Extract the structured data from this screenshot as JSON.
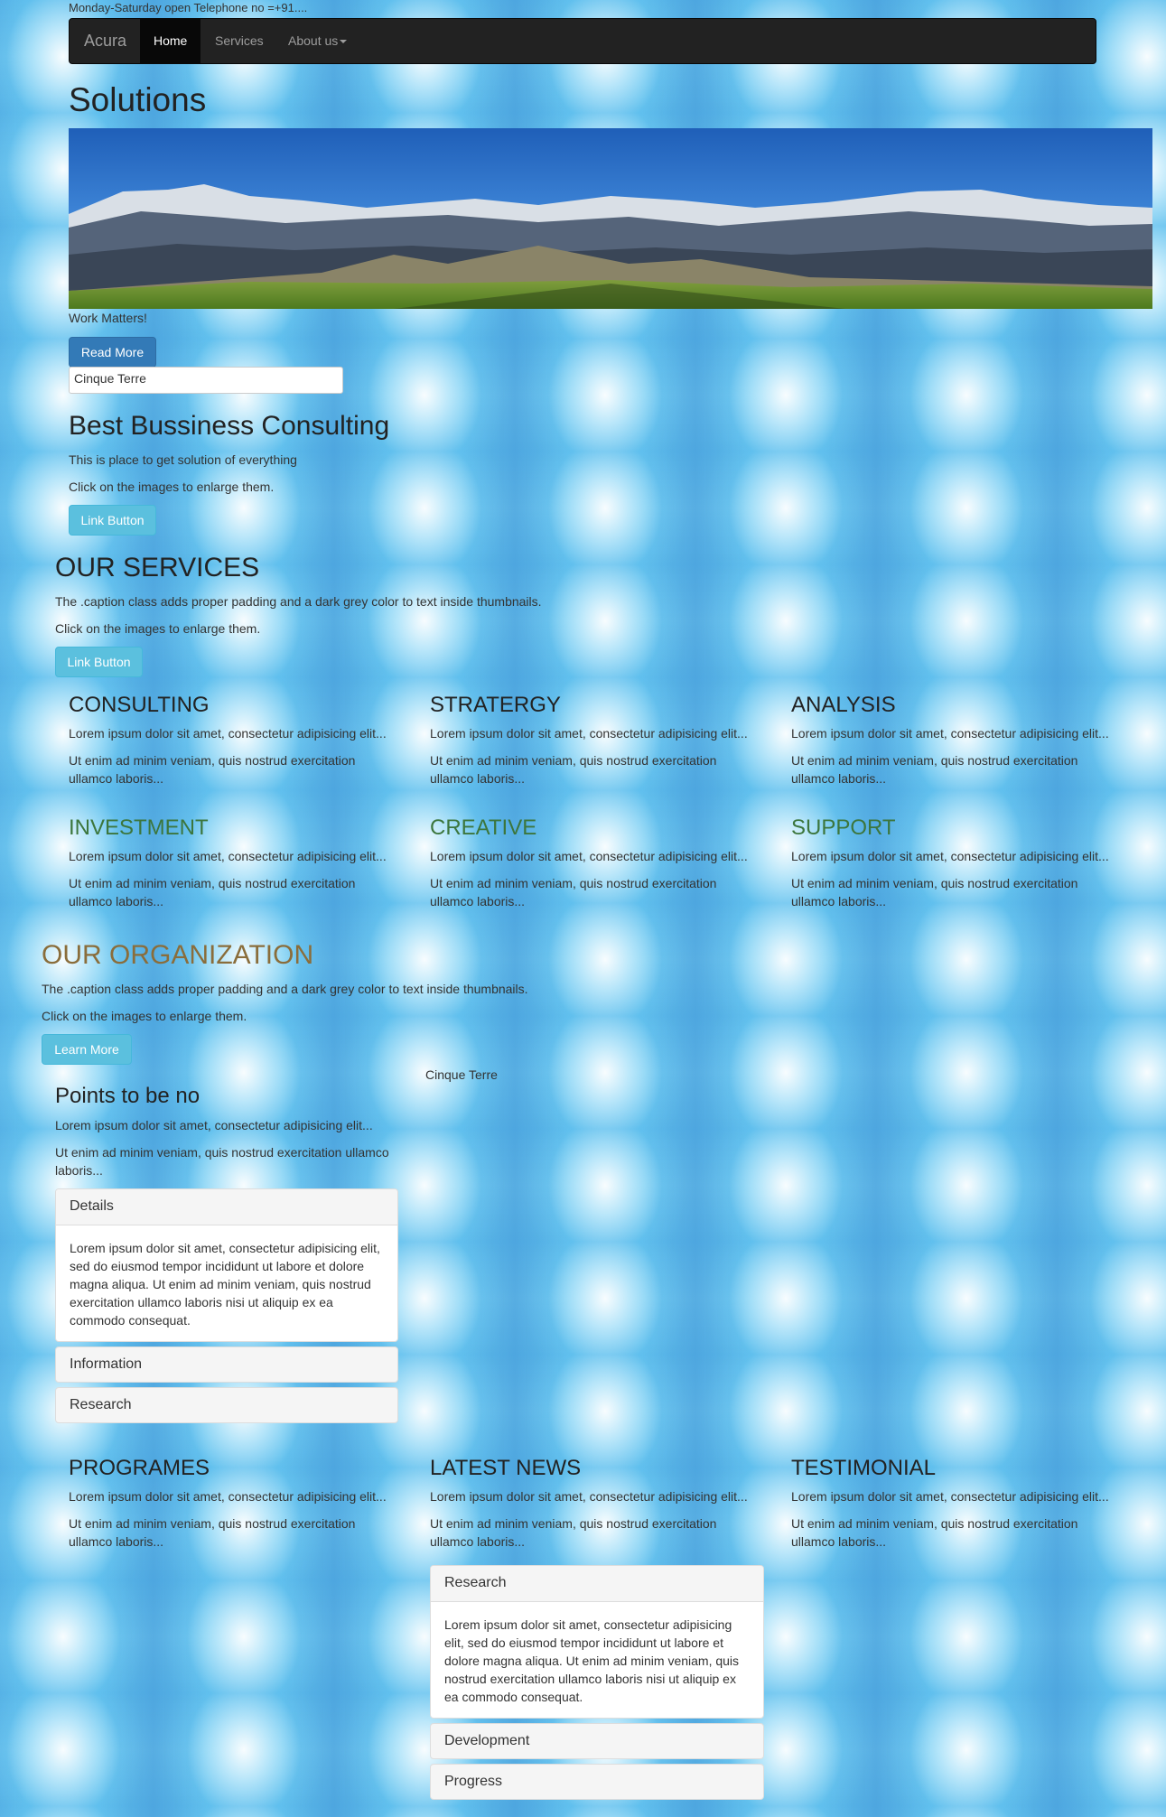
{
  "topbar": {
    "text": "Monday-Saturday open Telephone no =+91...."
  },
  "nav": {
    "brand": "Acura",
    "items": [
      "Home",
      "Services",
      "About us"
    ]
  },
  "hero": {
    "title": "Solutions",
    "tagline": "Work Matters!",
    "read_more": "Read More",
    "input_value": "Cinque Terre"
  },
  "consulting": {
    "title": "Best Bussiness Consulting",
    "p1": "This is place to get solution of everything",
    "p2": "Click on the images to enlarge them.",
    "button": "Link Button"
  },
  "services": {
    "title": "OUR SERVICES",
    "p1": "The .caption class adds proper padding and a dark grey color to text inside thumbnails.",
    "p2": "Click on the images to enlarge them.",
    "button": "Link Button",
    "items": [
      {
        "title": "CONSULTING",
        "p1": "Lorem ipsum dolor sit amet, consectetur adipisicing elit...",
        "p2a": "Ut enim ad minim veniam, quis nostrud exercitation",
        "p2b": "ullamco laboris..."
      },
      {
        "title": "STRATERGY",
        "p1": "Lorem ipsum dolor sit amet, consectetur adipisicing elit...",
        "p2a": "Ut enim ad minim veniam, quis nostrud exercitation",
        "p2b": "ullamco laboris..."
      },
      {
        "title": "ANALYSIS",
        "p1": "Lorem ipsum dolor sit amet, consectetur adipisicing elit...",
        "p2a": "Ut enim ad minim veniam, quis nostrud exercitation",
        "p2b": "ullamco laboris..."
      },
      {
        "title": "INVESTMENT",
        "p1": "Lorem ipsum dolor sit amet, consectetur adipisicing elit...",
        "p2a": "Ut enim ad minim veniam, quis nostrud exercitation",
        "p2b": "ullamco laboris..."
      },
      {
        "title": "CREATIVE",
        "p1": "Lorem ipsum dolor sit amet, consectetur adipisicing elit...",
        "p2a": "Ut enim ad minim veniam, quis nostrud exercitation",
        "p2b": "ullamco laboris..."
      },
      {
        "title": "SUPPORT",
        "p1": "Lorem ipsum dolor sit amet, consectetur adipisicing elit...",
        "p2a": "Ut enim ad minim veniam, quis nostrud exercitation",
        "p2b": "ullamco laboris..."
      }
    ]
  },
  "organization": {
    "title": "OUR ORGANIZATION",
    "p1": "The .caption class adds proper padding and a dark grey color to text inside thumbnails.",
    "p2": "Click on the images to enlarge them.",
    "button": "Learn More",
    "image_caption": "Cinque Terre"
  },
  "points": {
    "title": "Points to be no",
    "p1": "Lorem ipsum dolor sit amet, consectetur adipisicing elit...",
    "p2a": "Ut enim ad minim veniam, quis nostrud exercitation ullamco",
    "p2b": "laboris...",
    "accordion": [
      {
        "title": "Details",
        "body": "Lorem ipsum dolor sit amet, consectetur adipisicing elit, sed do eiusmod tempor incididunt ut labore et dolore magna aliqua. Ut enim ad minim veniam, quis nostrud exercitation ullamco laboris nisi ut aliquip ex ea commodo consequat."
      },
      {
        "title": "Information"
      },
      {
        "title": "Research"
      }
    ]
  },
  "bottom": {
    "cols": [
      {
        "title": "PROGRAMES",
        "p1": "Lorem ipsum dolor sit amet, consectetur adipisicing elit...",
        "p2a": "Ut enim ad minim veniam, quis nostrud exercitation",
        "p2b": "ullamco laboris..."
      },
      {
        "title": "LATEST NEWS",
        "p1": "Lorem ipsum dolor sit amet, consectetur adipisicing elit...",
        "p2a": "Ut enim ad minim veniam, quis nostrud exercitation",
        "p2b": "ullamco laboris..."
      },
      {
        "title": "TESTIMONIAL",
        "p1": "Lorem ipsum dolor sit amet, consectetur adipisicing elit...",
        "p2a": "Ut enim ad minim veniam, quis nostrud exercitation",
        "p2b": "ullamco laboris..."
      }
    ],
    "accordion": [
      {
        "title": "Research",
        "body": "Lorem ipsum dolor sit amet, consectetur adipisicing elit, sed do eiusmod tempor incididunt ut labore et dolore magna aliqua. Ut enim ad minim veniam, quis nostrud exercitation ullamco laboris nisi ut aliquip ex ea commodo consequat."
      },
      {
        "title": "Development"
      },
      {
        "title": "Progress"
      }
    ]
  }
}
